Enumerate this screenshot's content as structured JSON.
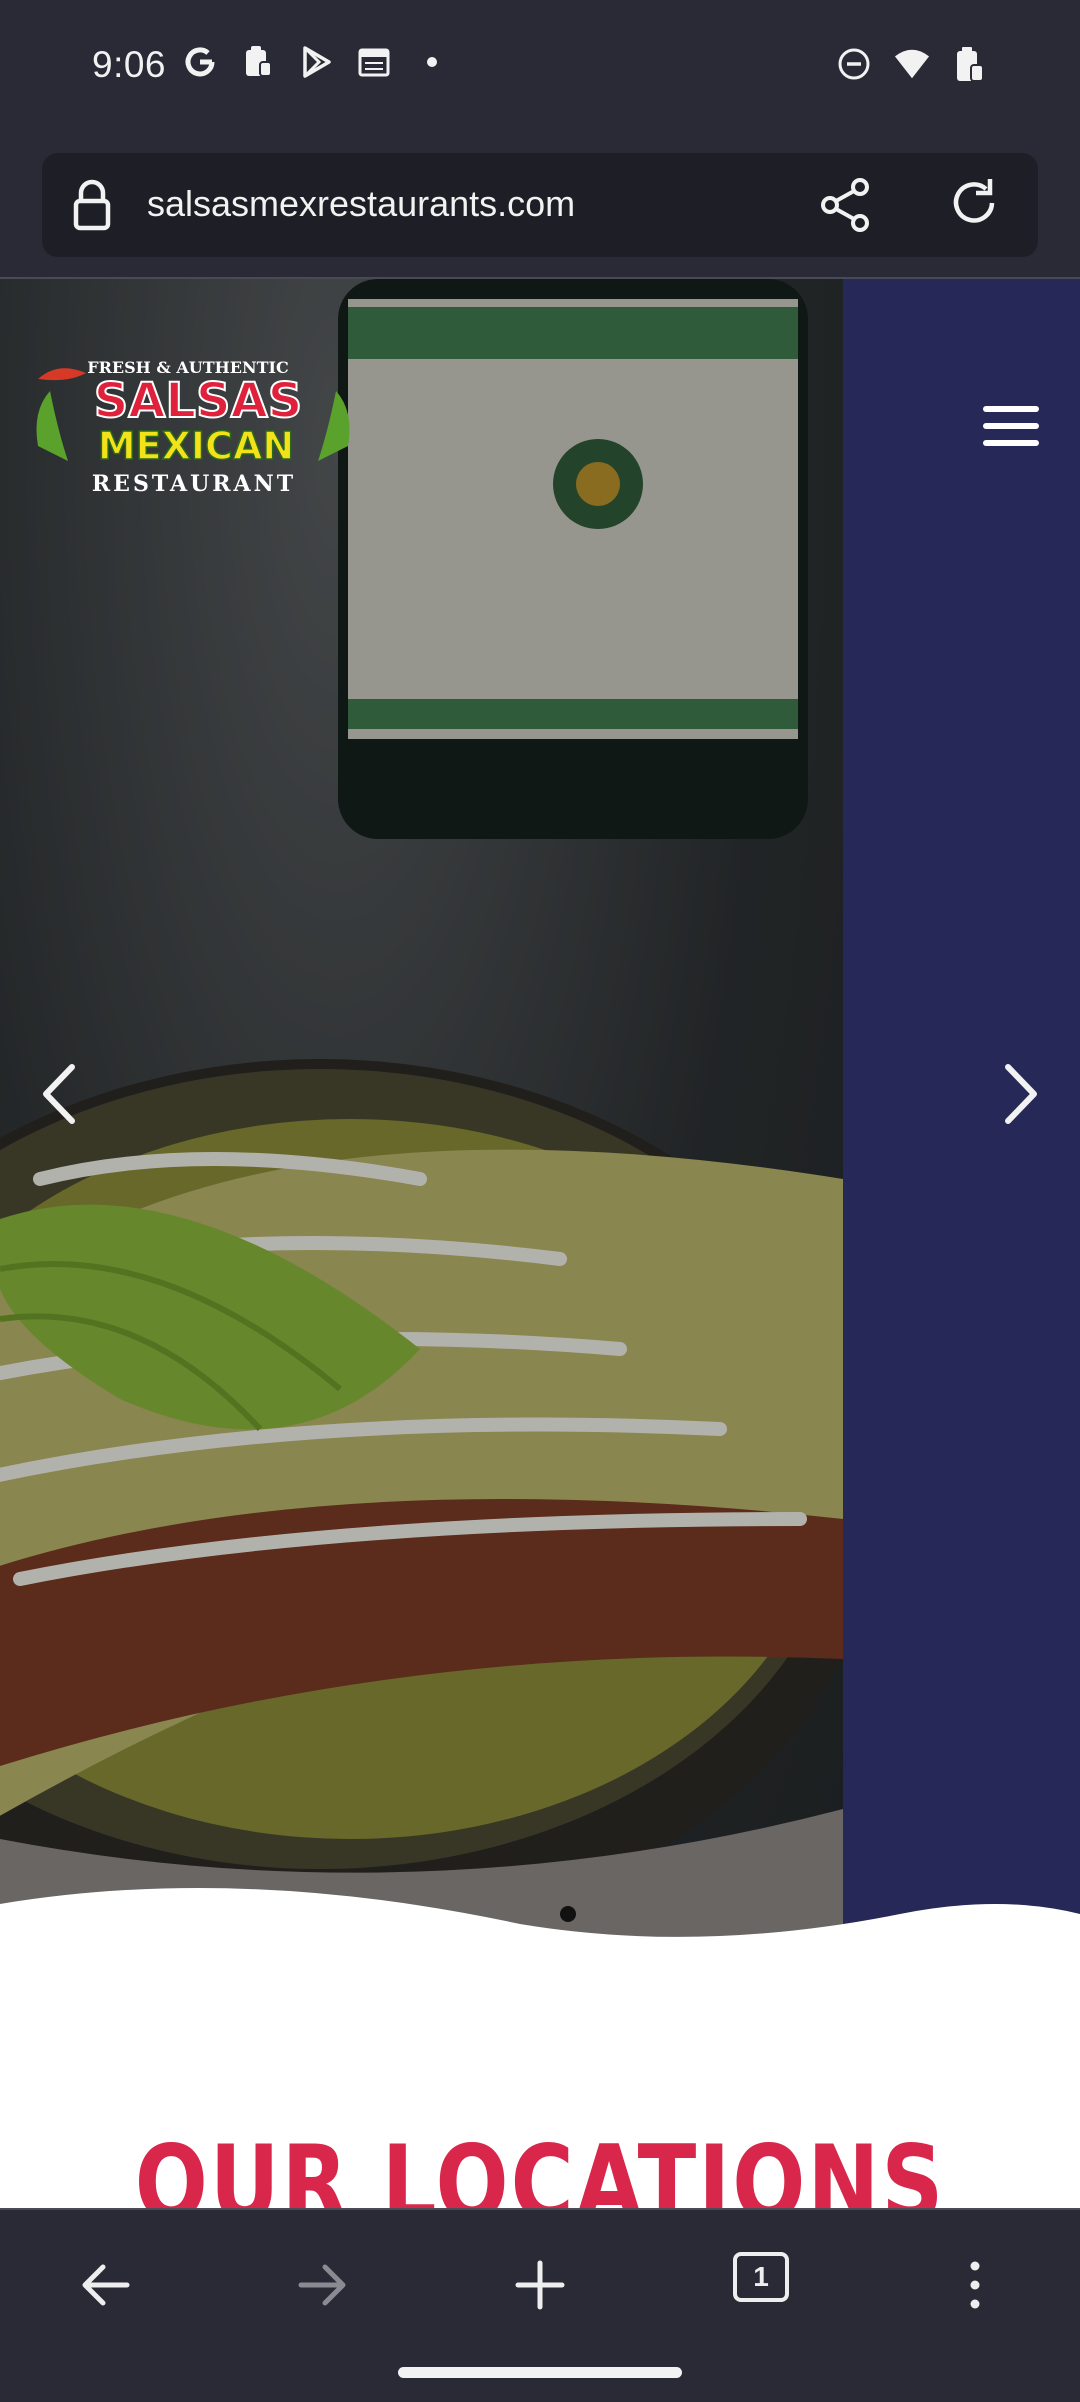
{
  "status_bar": {
    "time": "9:06",
    "left_icons": [
      "google-icon",
      "clipboard-icon",
      "play-store-icon",
      "calendar-icon",
      "dot-icon"
    ],
    "right_icons": [
      "do-not-disturb-icon",
      "wifi-icon",
      "battery-icon"
    ]
  },
  "browser": {
    "url": "salsasmexrestaurants.com"
  },
  "site": {
    "logo": {
      "line1": "FRESH & AUTHENTIC",
      "line2": "SALSAS",
      "line3": "MEXICAN",
      "line4": "RESTAURANT"
    },
    "hero": {
      "slide_count": 1,
      "active_slide": 1
    },
    "section_title": "OUR LOCATIONS"
  },
  "bottom_nav": {
    "tab_count": "1"
  },
  "colors": {
    "side_panel": "#262858",
    "title_red": "#d8274a",
    "chrome_bg": "#2a2a36"
  }
}
